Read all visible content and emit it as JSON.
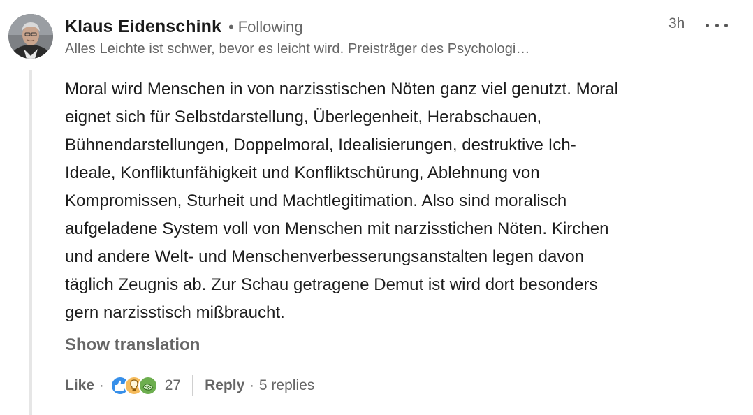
{
  "comment": {
    "author": {
      "name": "Klaus Eidenschink",
      "follow_separator": "•",
      "follow_status": "Following",
      "headline": "Alles Leichte ist schwer, bevor es leicht wird. Preisträger des Psychologi…",
      "avatar_icon": "profile-photo"
    },
    "timestamp": "3h",
    "more_icon": "ellipsis-icon",
    "body_lines": [
      "Moral wird Menschen in von narzisstischen Nöten ganz viel genutzt. Moral",
      "eignet sich für Selbstdarstellung, Überlegenheit, Herabschauen,",
      "Bühnendarstellungen, Doppelmoral, Idealisierungen, destruktive Ich-",
      "Ideale, Konfliktunfähigkeit und Konfliktschürung, Ablehnung von",
      "Kompromissen, Sturheit und Machtlegitimation. Also sind moralisch",
      "aufgeladene System voll von Menschen mit narzisstichen Nöten. Kirchen",
      "und andere Welt- und Menschenverbesserungsanstalten legen davon",
      "täglich Zeugnis ab. Zur Schau getragene Demut ist wird dort besonders",
      "gern narzisstisch mißbraucht."
    ],
    "show_translation": "Show translation",
    "actions": {
      "like_label": "Like",
      "dot": "·",
      "reactions": [
        {
          "name": "like-reaction-icon",
          "color": "#378fe9"
        },
        {
          "name": "insightful-reaction-icon",
          "color": "#f5bb5c"
        },
        {
          "name": "support-reaction-icon",
          "color": "#6dae4f"
        }
      ],
      "reaction_count": "27",
      "reply_label": "Reply",
      "replies_count": "5 replies"
    }
  }
}
